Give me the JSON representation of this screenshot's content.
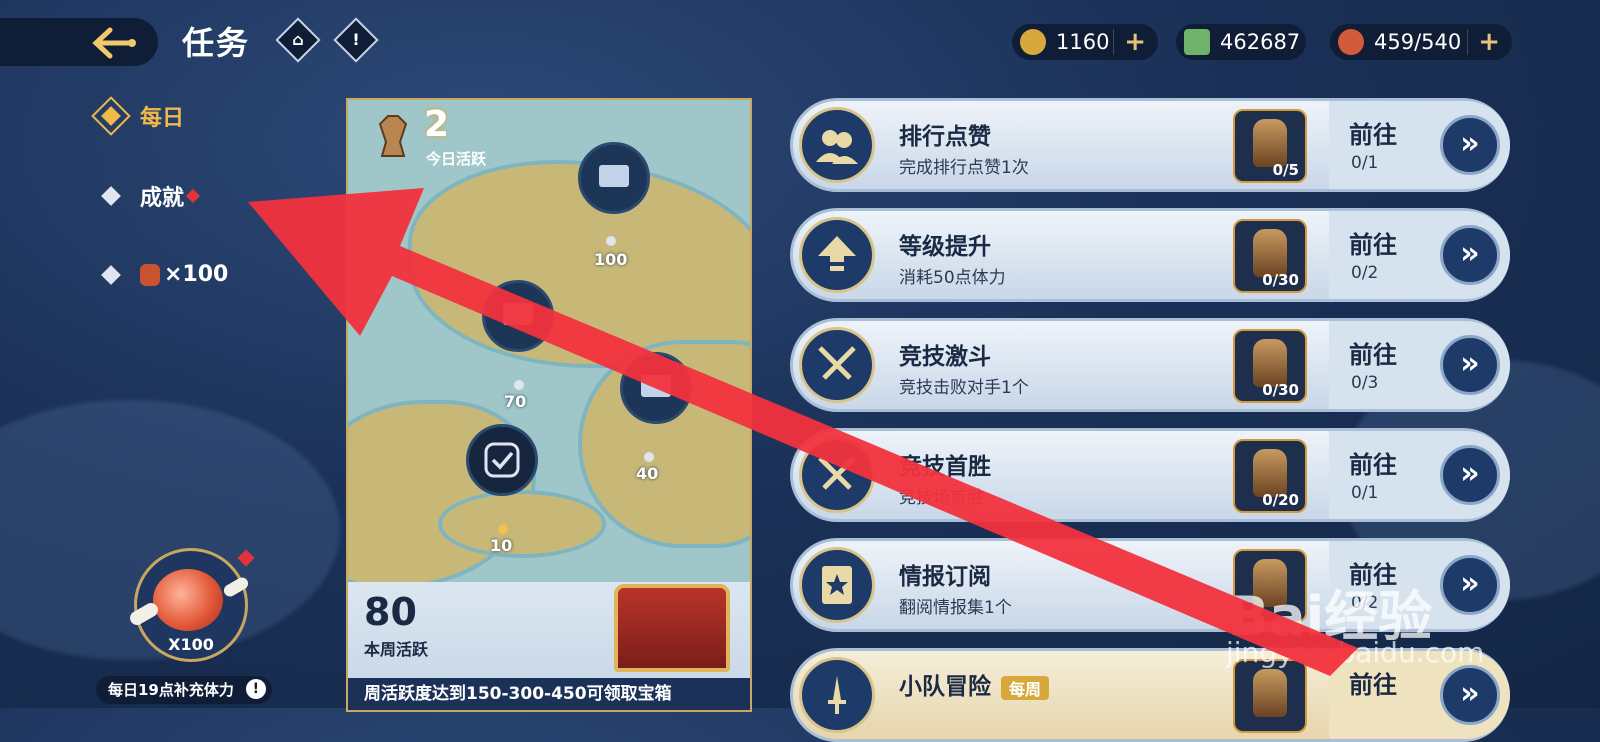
{
  "header": {
    "title": "任务",
    "back_icon": "anchor-back-icon",
    "home_icon": "home-icon",
    "info_icon": "exclamation-icon"
  },
  "currencies": [
    {
      "name": "gold",
      "icon": "coin-icon",
      "value": "1160",
      "has_plus": true
    },
    {
      "name": "cash",
      "icon": "money-icon",
      "value": "462687",
      "has_plus": false
    },
    {
      "name": "stamina",
      "icon": "meat-icon",
      "value": "459/540",
      "has_plus": true
    }
  ],
  "nav": {
    "daily": "每日",
    "achievement": "成就",
    "item_count": "×100"
  },
  "stamina_widget": {
    "count": "X100",
    "note": "每日19点补充体力",
    "note_icon": "!"
  },
  "map_panel": {
    "today_value": "2",
    "today_label": "今日活跃",
    "milestones": [
      "100",
      "70",
      "40",
      "10"
    ],
    "week_value": "80",
    "week_label": "本周活跃",
    "week_note": "周活跃度达到150-300-450可领取宝箱"
  },
  "tasks": [
    {
      "name": "排行点赞",
      "desc": "完成排行点赞1次",
      "reward_count": "0/5",
      "goto": "前往",
      "progress": "0/1",
      "icon": "users-icon"
    },
    {
      "name": "等级提升",
      "desc": "消耗50点体力",
      "reward_count": "0/30",
      "goto": "前往",
      "progress": "0/2",
      "icon": "level-up-icon"
    },
    {
      "name": "竞技激斗",
      "desc": "竞技击败对手1个",
      "reward_count": "0/30",
      "goto": "前往",
      "progress": "0/3",
      "icon": "swords-icon"
    },
    {
      "name": "竞技首胜",
      "desc": "竞技场首胜",
      "reward_count": "0/20",
      "goto": "前往",
      "progress": "0/1",
      "icon": "swords-icon"
    },
    {
      "name": "情报订阅",
      "desc": "翻阅情报集1个",
      "reward_count": "",
      "goto": "前往",
      "progress": "0/2",
      "icon": "book-icon"
    },
    {
      "name": "小队冒险",
      "tag": "每周",
      "desc": "",
      "reward_count": "",
      "goto": "前往",
      "progress": "",
      "icon": "dagger-icon"
    }
  ],
  "watermark": {
    "brand": "Bai经验",
    "url": "jingyan.baidu.com"
  },
  "colors": {
    "accent_gold": "#f0b94a",
    "annotation_arrow": "#f2323d",
    "background": "#1b3158"
  }
}
